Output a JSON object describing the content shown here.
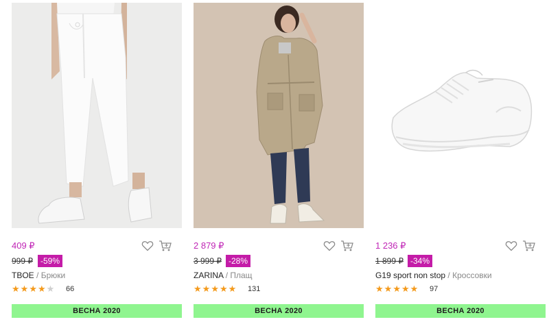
{
  "colors": {
    "price": "#c026b6",
    "discount_bg": "#c41ca8",
    "badge_bg": "#8ff58f",
    "star": "#f49a1c"
  },
  "products": [
    {
      "price": "409 ₽",
      "old_price": "999 ₽",
      "discount": "-59%",
      "brand": "TBOE",
      "separator": "/",
      "category": "Брюки",
      "rating": 4,
      "rating_max": 5,
      "reviews": "66",
      "badge": "ВЕСНА 2020",
      "image": "white-joggers-photo",
      "favorite_icon": "heart-icon",
      "cart_icon": "cart-icon"
    },
    {
      "price": "2 879 ₽",
      "old_price": "3 999 ₽",
      "discount": "-28%",
      "brand": "ZARINA",
      "separator": "/",
      "category": "Плащ",
      "rating": 5,
      "rating_max": 5,
      "reviews": "131",
      "badge": "ВЕСНА 2020",
      "image": "beige-raincoat-photo",
      "favorite_icon": "heart-icon",
      "cart_icon": "cart-icon"
    },
    {
      "price": "1 236 ₽",
      "old_price": "1 899 ₽",
      "discount": "-34%",
      "brand": "G19 sport non stop",
      "separator": "/",
      "category": "Кроссовки",
      "rating": 5,
      "rating_max": 5,
      "reviews": "97",
      "badge": "ВЕСНА 2020",
      "image": "white-sneaker-photo",
      "favorite_icon": "heart-icon",
      "cart_icon": "cart-icon"
    }
  ]
}
